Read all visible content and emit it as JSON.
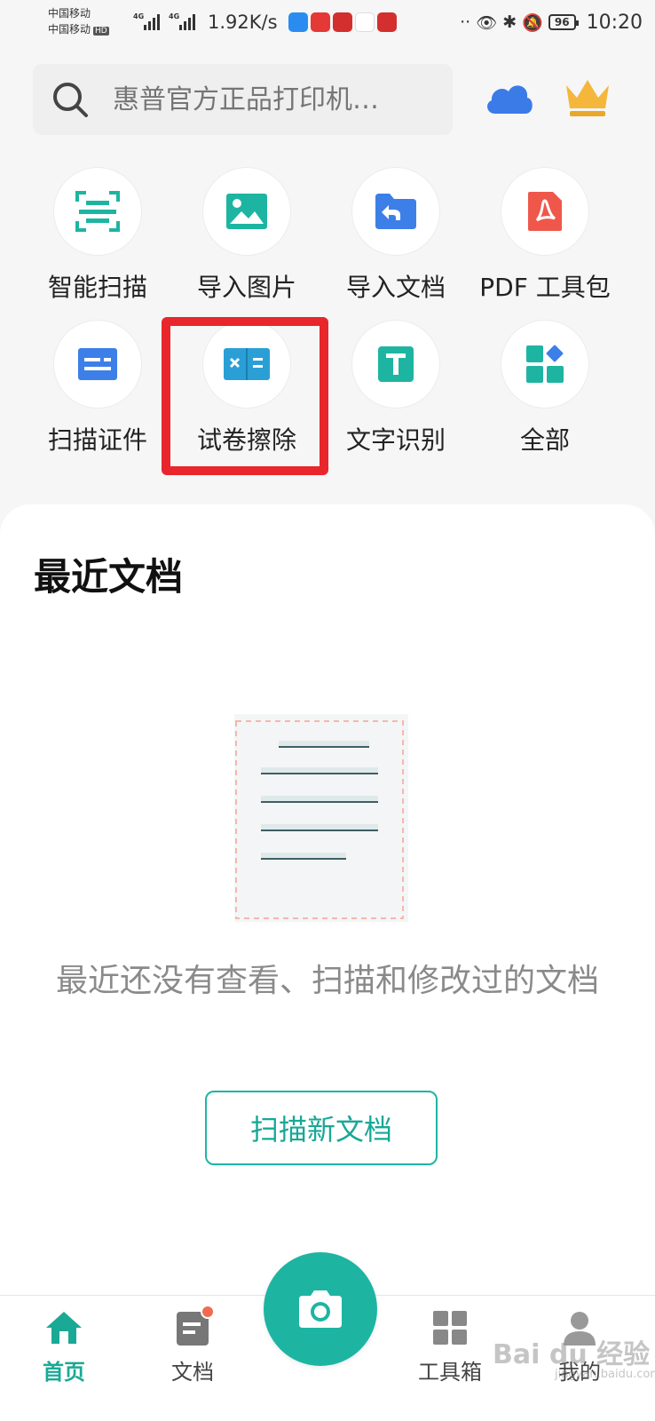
{
  "status_bar": {
    "carrier_1": "中国移动",
    "carrier_2": "中国移动",
    "hd_badge": "HD",
    "network_1": "4G",
    "network_2": "4G",
    "net_speed": "1.92K/s",
    "battery": "96",
    "time": "10:20"
  },
  "header": {
    "search_placeholder": "惠普官方正品打印机…",
    "cloud_icon": "cloud-icon",
    "crown_icon": "crown-icon"
  },
  "tools": [
    {
      "label": "智能扫描",
      "icon": "smart-scan-icon"
    },
    {
      "label": "导入图片",
      "icon": "import-image-icon"
    },
    {
      "label": "导入文档",
      "icon": "import-document-icon"
    },
    {
      "label": "PDF 工具包",
      "icon": "pdf-toolkit-icon"
    },
    {
      "label": "扫描证件",
      "icon": "id-card-scan-icon"
    },
    {
      "label": "试卷擦除",
      "icon": "exam-erase-icon"
    },
    {
      "label": "文字识别",
      "icon": "text-recognition-icon"
    },
    {
      "label": "全部",
      "icon": "all-tools-icon"
    }
  ],
  "recent": {
    "title": "最近文档",
    "empty_text": "最近还没有查看、扫描和修改过的文档",
    "scan_button": "扫描新文档"
  },
  "bottom_nav": {
    "items": [
      {
        "label": "首页",
        "icon": "home-icon",
        "active": true
      },
      {
        "label": "文档",
        "icon": "document-icon",
        "active": false
      },
      {
        "label": "工具箱",
        "icon": "toolbox-icon",
        "active": false
      },
      {
        "label": "我的",
        "icon": "profile-icon",
        "active": false
      }
    ],
    "camera_icon": "camera-icon"
  },
  "watermark": {
    "brand": "Bai du 经验",
    "url": "jingyan.baidu.com"
  },
  "colors": {
    "accent": "#1db5a2",
    "highlight": "#e8262c",
    "badge": "#f26a4f"
  }
}
